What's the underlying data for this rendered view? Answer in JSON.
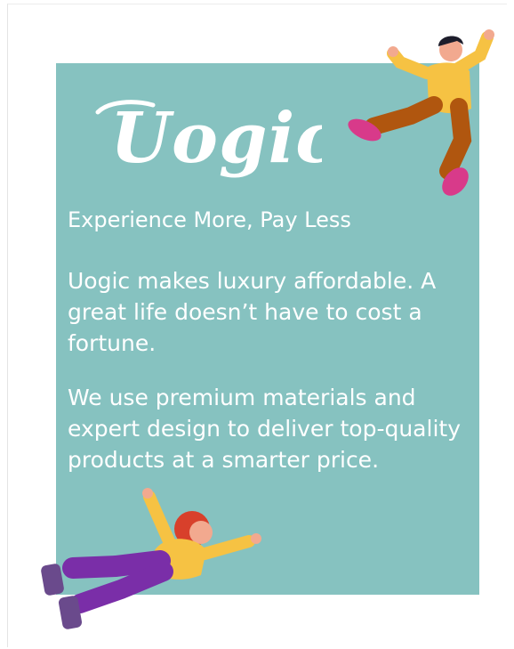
{
  "brand": {
    "logo_text": "Uogic"
  },
  "tagline": "Experience More, Pay Less",
  "paragraphs": [
    "Uogic makes luxury affordable. A great life doesn’t have to cost a fortune.",
    "We use premium materials and expert design to deliver top-quality products at a smarter price."
  ],
  "colors": {
    "card_background": "#86c2c0",
    "text": "#ffffff",
    "shirt_yellow": "#f6c243",
    "pants_brown": "#b0560f",
    "pants_purple": "#7a2ea8",
    "shoes_pink": "#d83a8a",
    "shoes_purple": "#6a4a8c",
    "hair_dark": "#1d1d2b",
    "hair_red": "#d8402b"
  },
  "illustrations": [
    "jumping-man-icon",
    "flying-woman-icon"
  ]
}
